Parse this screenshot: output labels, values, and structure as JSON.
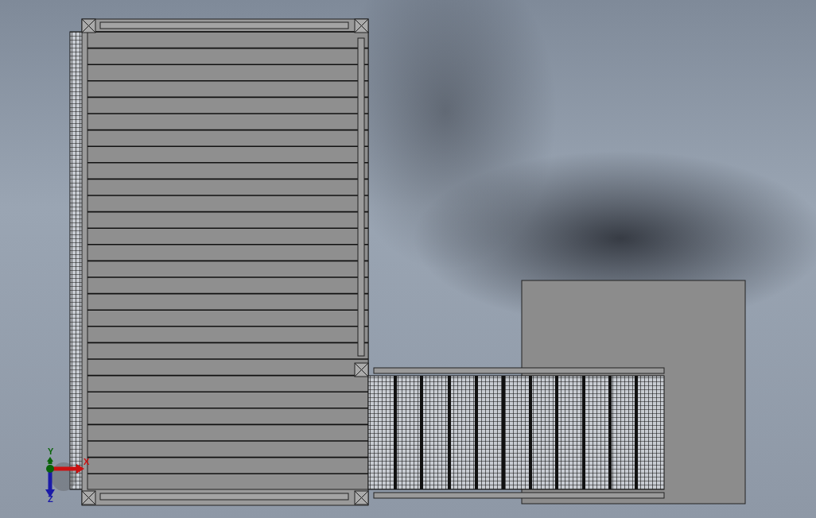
{
  "viewport": {
    "triad": {
      "axes": [
        {
          "label": "Y",
          "color": "#0a640a"
        },
        {
          "label": "X",
          "color": "#cc1111"
        },
        {
          "label": "Z",
          "color": "#1a1aa8"
        }
      ]
    }
  }
}
